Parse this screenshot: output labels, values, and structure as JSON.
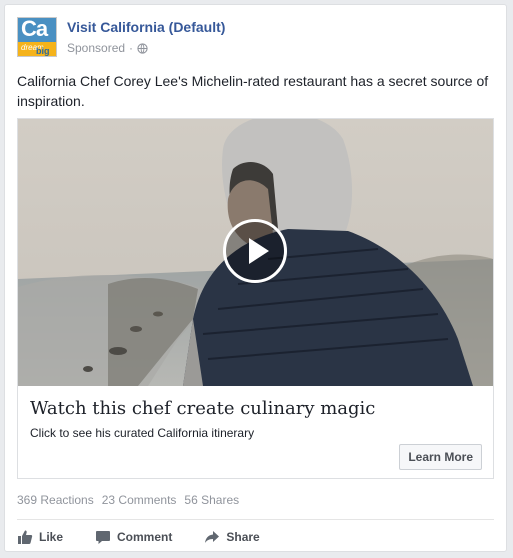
{
  "post": {
    "page_name": "Visit California (Default)",
    "sponsored": "Sponsored",
    "separator": "·",
    "logo_text": "Ca",
    "logo_sub_1": "dream",
    "logo_sub_2": "big",
    "text": "California Chef Corey Lee's Michelin-rated restaurant has a secret source of inspiration."
  },
  "ad": {
    "headline": "Watch this chef create culinary magic",
    "description": "Click to see his curated California itinerary",
    "cta_label": "Learn More"
  },
  "stats": {
    "reactions": "369 Reactions",
    "comments": "23 Comments",
    "shares": "56 Shares"
  },
  "actions": {
    "like": "Like",
    "comment": "Comment",
    "share": "Share"
  },
  "icons": {
    "globe": "globe-icon",
    "play": "play-icon",
    "like": "thumbs-up-icon",
    "comment": "comment-bubble-icon",
    "share": "share-arrow-icon"
  },
  "colors": {
    "link_blue": "#365899",
    "muted": "#90949c",
    "text": "#1d2129"
  }
}
